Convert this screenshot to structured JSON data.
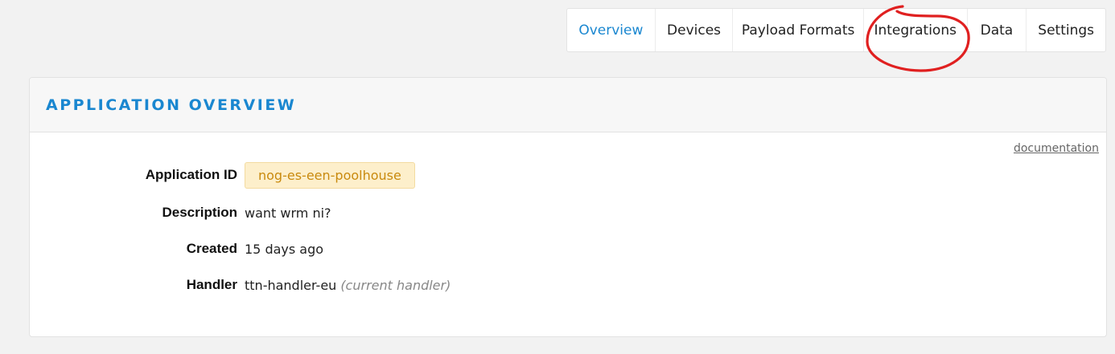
{
  "tabs": [
    {
      "label": "Overview",
      "active": true
    },
    {
      "label": "Devices",
      "active": false
    },
    {
      "label": "Payload Formats",
      "active": false
    },
    {
      "label": "Integrations",
      "active": false
    },
    {
      "label": "Data",
      "active": false
    },
    {
      "label": "Settings",
      "active": false
    }
  ],
  "annotation": {
    "shape": "hand-drawn-circle",
    "color": "#e02020",
    "target": "Integrations"
  },
  "card": {
    "title": "APPLICATION OVERVIEW",
    "documentation_link": "documentation",
    "fields": {
      "application_id": {
        "label": "Application ID",
        "value": "nog-es-een-poolhouse"
      },
      "description": {
        "label": "Description",
        "value": "want wrm ni?"
      },
      "created": {
        "label": "Created",
        "value": "15 days ago"
      },
      "handler": {
        "label": "Handler",
        "value": "ttn-handler-eu",
        "note": "(current handler)"
      }
    }
  },
  "colors": {
    "accent": "#1a87d0",
    "badge_bg": "#fdefcb",
    "badge_text": "#c98a0e",
    "background": "#f2f2f2"
  }
}
